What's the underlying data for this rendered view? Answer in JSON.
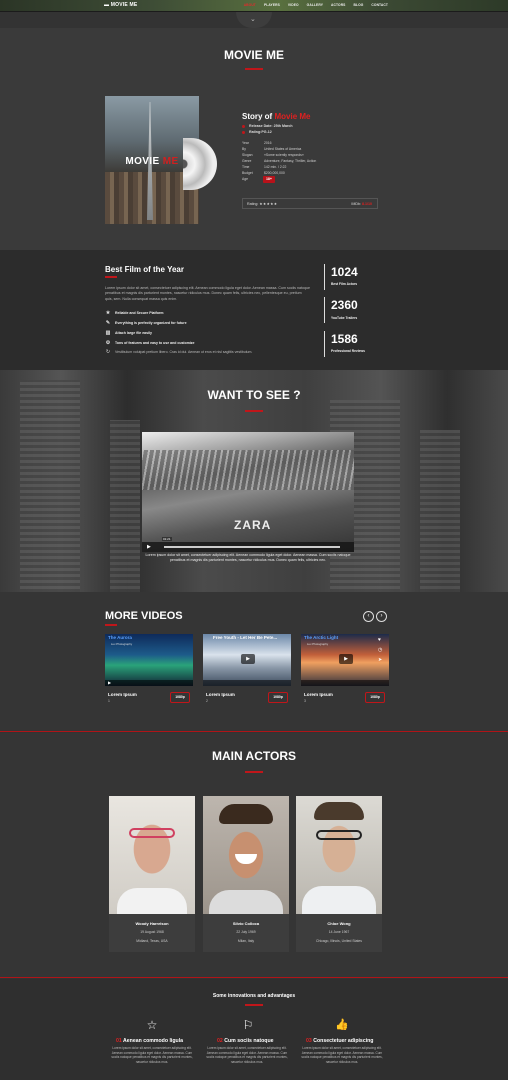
{
  "nav": {
    "logo": "MOVIE ME",
    "items": [
      "ABOUT",
      "PLAYERS",
      "VIDEO",
      "GALLERY",
      "ACTORS",
      "BLOG",
      "CONTACT"
    ]
  },
  "hero": {
    "title": "MOVIE ME",
    "poster_title_a": "MOVIE",
    "poster_title_b": "ME",
    "story_prefix": "Story of",
    "story_name": "Movie Me",
    "release": "Release Date: 25th March",
    "rating_line": "Rating:PG-12",
    "info": [
      {
        "k": "Year",
        "v": "2016"
      },
      {
        "k": "By",
        "v": "United States of America"
      },
      {
        "k": "Slogan",
        "v": "«Some sciently responds»"
      },
      {
        "k": "Genre",
        "v": "Adventure, Fantasy, Thriller, Action"
      },
      {
        "k": "Time",
        "v": "142 min. / 2:22"
      },
      {
        "k": "Budget",
        "v": "$200,000,000"
      },
      {
        "k": "Age",
        "v": ""
      }
    ],
    "age_badge": "18+",
    "rating_label": "Rating:",
    "stars": "★★★★★",
    "imdb_label": "IMDb:",
    "imdb_value": "8.1/10"
  },
  "best": {
    "title": "Best Film of the Year",
    "para": "Lorem ipsum dolor sit amet, consectetuer adipiscing elit. Aenean commodo ligula eget dolor. Aenean massa. Cum sociis natoque penatibus et magnis dis parturient montes, nascetur ridiculus mus. Donec quam felis, ultricies nec, pellentesque eu, pretium quis, sem. Nulla consequat massa quis enim.",
    "features": [
      {
        "icon": "★",
        "text": "Reliable and Secure Platform"
      },
      {
        "icon": "✎",
        "text": "Everything is perfectly organized for future"
      },
      {
        "icon": "▥",
        "text": "Attach large file easily"
      },
      {
        "icon": "⚙",
        "text": "Tons of features and easy to use and customize"
      },
      {
        "icon": "↻",
        "text": "Vestibulum volutpat pretium libero. Cras id dui. Aenean ut eros et nisl sagittis vestibulum."
      }
    ],
    "stats": [
      {
        "num": "1024",
        "label": "Best Film Actors"
      },
      {
        "num": "2360",
        "label": "YouTube Trailers"
      },
      {
        "num": "1586",
        "label": "Professional Reviews"
      }
    ]
  },
  "want": {
    "title": "WANT TO SEE ?",
    "video_text": "ZARA",
    "time_tag": "01:21",
    "caption": "Lorem ipsum dolor sit amet, consectetuer adipiscing elit. Aenean commodo ligula eget dolor. Aenean massa. Cum sociis natoque penatibus et magnis dis parturient montes, nascetur ridiculus mus. Donec quam felis, ultricies nec."
  },
  "more": {
    "title": "MORE VIDEOS",
    "prev": "‹",
    "next": "›",
    "videos": [
      {
        "thumb_title": "The Aurora",
        "thumb_sub": "Lux Photography",
        "title": "Lorem Ipsum",
        "num": "1",
        "hd": "1080p"
      },
      {
        "thumb_title": "Free Youth - Let Her Be Pete...",
        "thumb_sub": "",
        "title": "Lorem Ipsum",
        "num": "2",
        "hd": "1080p"
      },
      {
        "thumb_title": "The Arctic Light",
        "thumb_sub": "Lux Photography",
        "title": "Lorem Ipsum",
        "num": "3",
        "hd": "1080p"
      }
    ]
  },
  "actors": {
    "title": "MAIN ACTORS",
    "list": [
      {
        "name": "Woody Harrelson",
        "date": "19 August 1968",
        "place": "Midland, Texas, USA"
      },
      {
        "name": "Silvio Colloca",
        "date": "22 July 1969",
        "place": "Milan, Italy"
      },
      {
        "name": "Chloe Wong",
        "date": "14 June 1967",
        "place": "Chicago, Illinois, United States"
      }
    ]
  },
  "inno": {
    "title": "Some innovations and advantages",
    "items": [
      {
        "icon": "star-icon",
        "glyph": "☆",
        "num": "01",
        "head": "Aenean commodo ligula",
        "text": "Lorem ipsum dolor sit amet, consectetuer adipiscing elit. Aenean commodo ligula eget dolor. Aenean massa. Cum sociis natoque penatibus et magnis dis parturient montes, nascetur ridiculus mus."
      },
      {
        "icon": "flag-icon",
        "glyph": "⚐",
        "num": "02",
        "head": "Cum sociis natoque",
        "text": "Lorem ipsum dolor sit amet, consectetuer adipiscing elit. Aenean commodo ligula eget dolor. Aenean massa. Cum sociis natoque penatibus et magnis dis parturient montes, nascetur ridiculus mus."
      },
      {
        "icon": "thumbs-up-icon",
        "glyph": "👍",
        "num": "03",
        "head": "Consectetuer adipiscing",
        "text": "Lorem ipsum dolor sit amet, consectetuer adipiscing elit. Aenean commodo ligula eget dolor. Aenean massa. Cum sociis natoque penatibus et magnis dis parturient montes, nascetur ridiculus mus."
      }
    ]
  }
}
